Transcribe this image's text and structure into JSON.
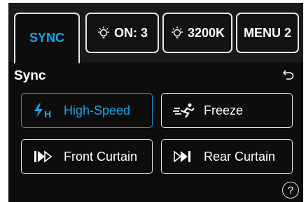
{
  "tabs": [
    {
      "label": "SYNC",
      "icon": null,
      "active": true
    },
    {
      "label": "ON: 3",
      "icon": "bulb-icon",
      "active": false
    },
    {
      "label": "3200K",
      "icon": "bulb-icon",
      "active": false
    },
    {
      "label": "MENU 2",
      "icon": null,
      "active": false
    }
  ],
  "section": {
    "title": "Sync",
    "back_icon": "back-arrow-icon"
  },
  "options": [
    {
      "label": "High-Speed",
      "icon": "high-speed-sync-icon",
      "selected": true
    },
    {
      "label": "Freeze",
      "icon": "freeze-runner-icon",
      "selected": false
    },
    {
      "label": "Front Curtain",
      "icon": "front-curtain-icon",
      "selected": false
    },
    {
      "label": "Rear Curtain",
      "icon": "rear-curtain-icon",
      "selected": false
    }
  ],
  "help": {
    "label": "?"
  },
  "colors": {
    "accent": "#17a6e8",
    "background": "#0d0d0d",
    "border": "#e8e8e8"
  }
}
